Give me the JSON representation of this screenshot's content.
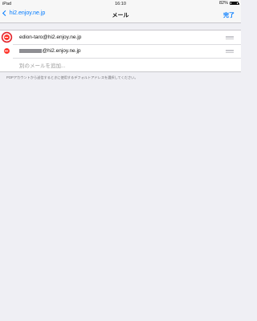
{
  "status_bar": {
    "device": "iPad",
    "time": "16:10",
    "battery_text": "82%",
    "battery_level": 0.82
  },
  "nav": {
    "back_label": "hi2.enjoy.ne.jp",
    "title": "メール",
    "done_label": "完了"
  },
  "emails": [
    {
      "address": "edion-taro@hi2.enjoy.ne.jp",
      "redacted_prefix": false
    },
    {
      "address": "@hi2.enjoy.ne.jp",
      "redacted_prefix": true
    }
  ],
  "add_email_label": "別のメールを追加...",
  "footnote": "POPアカウントから送信するときに使用するデフォルトアドレスを選択してください。",
  "colors": {
    "accent": "#007aff",
    "delete": "#ff3b30",
    "highlight_ring": "#e3262c"
  },
  "icons": {
    "back": "chevron-left-icon",
    "delete": "minus-circle-icon",
    "reorder": "reorder-grip-icon"
  }
}
